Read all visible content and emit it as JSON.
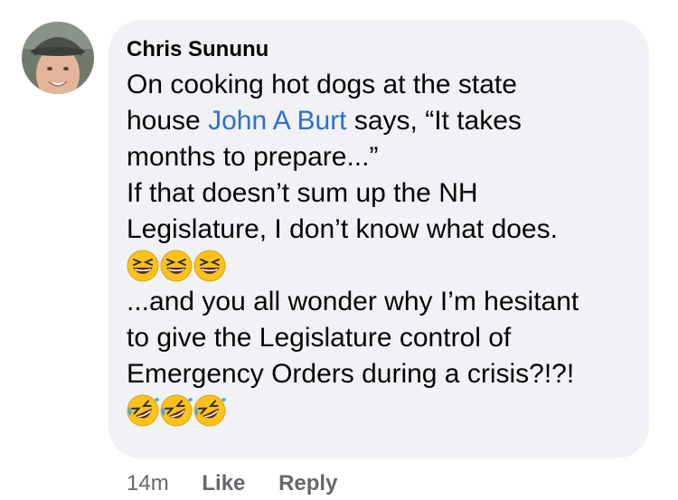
{
  "comment": {
    "author": "Chris Sununu",
    "lines_before_mention": "On cooking hot dogs at the state",
    "text_house": "house ",
    "mention": "John A Burt",
    "text_after_mention": " says, “It takes",
    "line_3": "months to prepare...”",
    "line_4": "If that doesn’t sum up the NH",
    "line_5": "Legislature, I don’t know what does.",
    "line_6": "...and you all wonder why I’m hesitant",
    "line_7": "to give the Legislature control of",
    "line_8": "Emergency Orders during a crisis?!?!",
    "emoji_group_1": [
      "grinning-squinting-face",
      "grinning-squinting-face",
      "grinning-squinting-face"
    ],
    "emoji_group_2": [
      "rolling-on-floor-laughing",
      "rolling-on-floor-laughing",
      "rolling-on-floor-laughing"
    ]
  },
  "actions": {
    "time": "14m",
    "like": "Like",
    "reply": "Reply"
  },
  "colors": {
    "bubble": "#f0f2f5",
    "mention": "#2d6fd2",
    "meta": "#65676b"
  }
}
